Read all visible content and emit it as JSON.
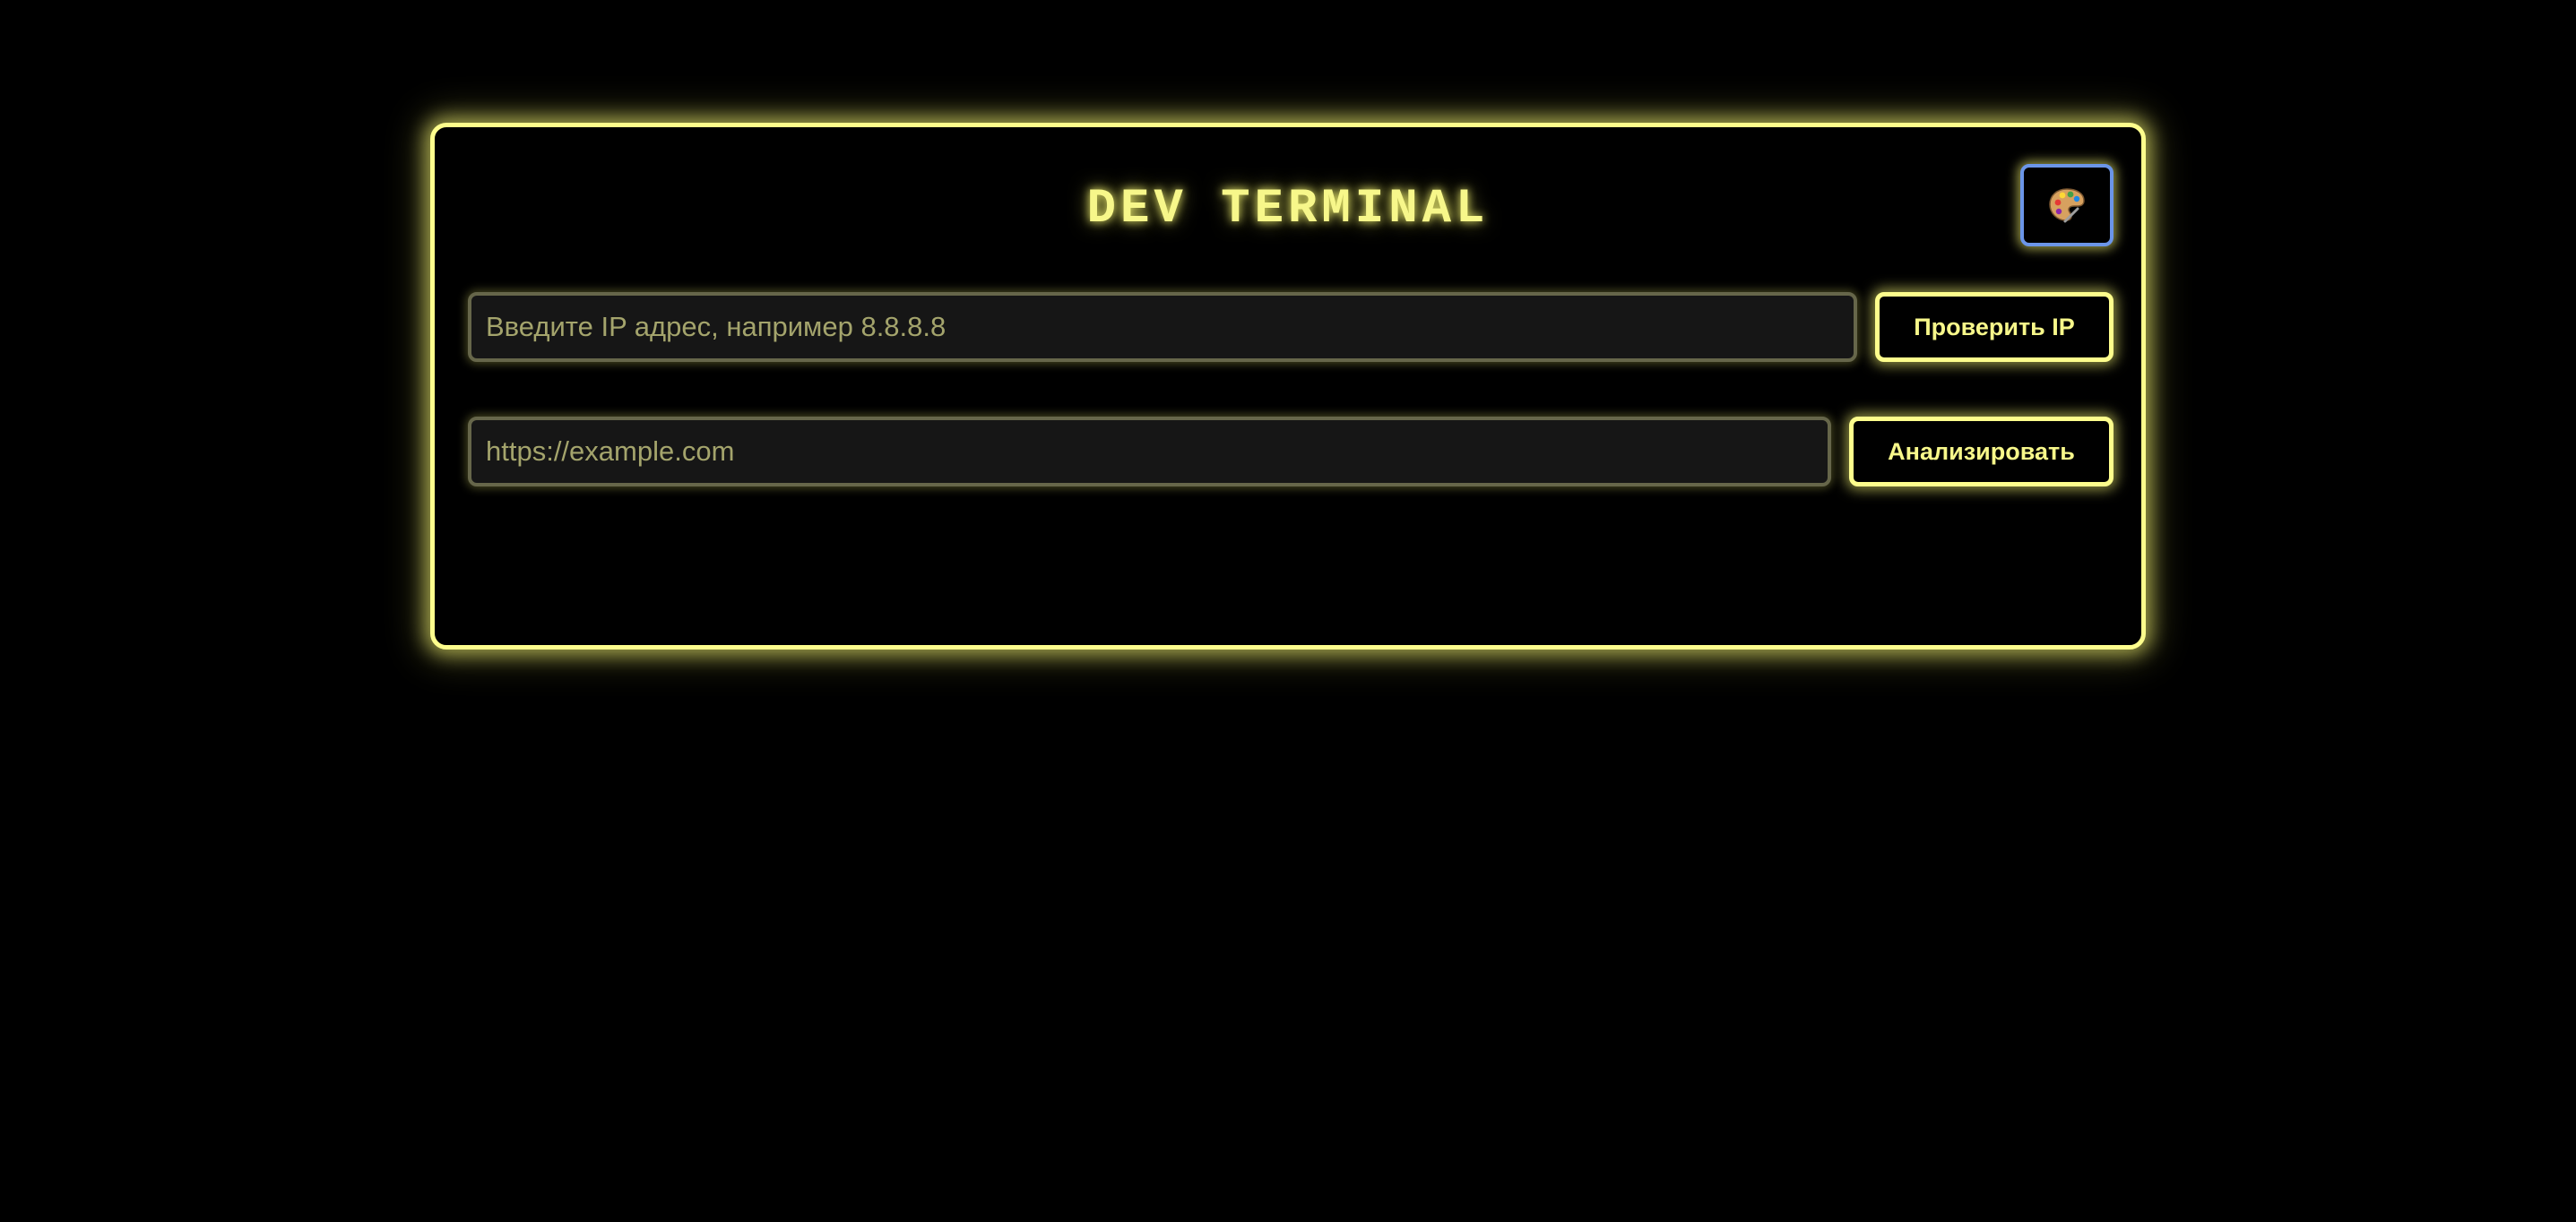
{
  "terminal": {
    "title": "DEV TERMINAL",
    "theme_button_icon": "palette-icon"
  },
  "ip_check": {
    "placeholder": "Введите IP адрес, например 8.8.8.8",
    "value": "",
    "button_label": "Проверить IP"
  },
  "url_analyze": {
    "placeholder": "https://example.com",
    "value": "",
    "button_label": "Анализировать"
  },
  "colors": {
    "background": "#000000",
    "accent": "#fdfd8c",
    "theme_button_border": "#6b95e8",
    "input_background": "#161616",
    "placeholder_text": "#a4a46c"
  }
}
